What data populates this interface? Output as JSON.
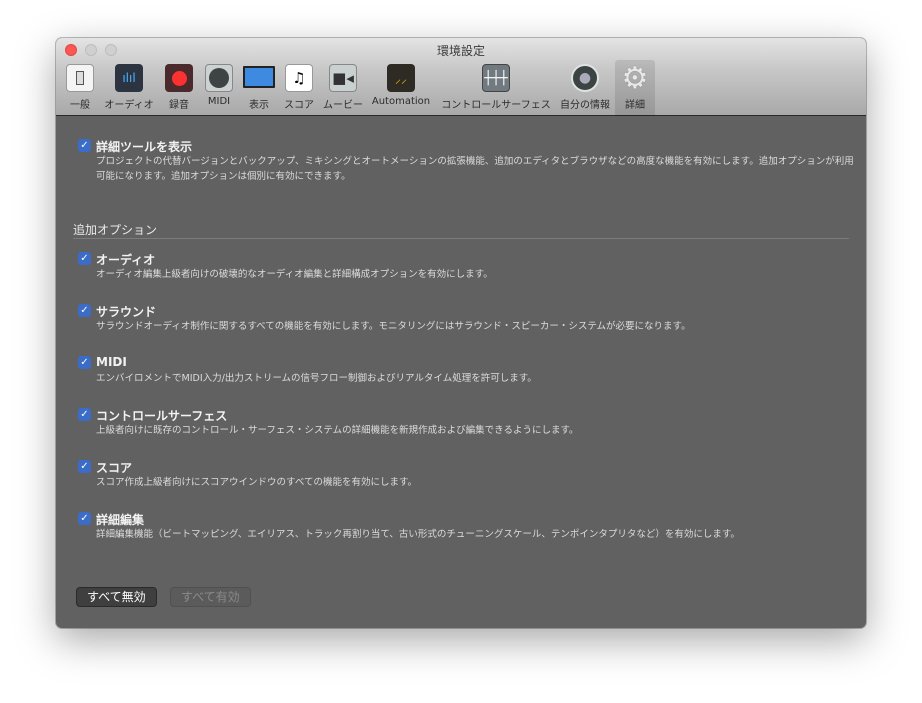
{
  "window": {
    "title": "環境設定"
  },
  "toolbar": [
    {
      "id": "general",
      "label": "一般",
      "icon": "switch-icon"
    },
    {
      "id": "audio",
      "label": "オーディオ",
      "icon": "waveform-icon"
    },
    {
      "id": "record",
      "label": "録音",
      "icon": "record-icon"
    },
    {
      "id": "midi",
      "label": "MIDI",
      "icon": "midi-port-icon"
    },
    {
      "id": "display",
      "label": "表示",
      "icon": "monitor-icon"
    },
    {
      "id": "score",
      "label": "スコア",
      "icon": "music-note-icon"
    },
    {
      "id": "movie",
      "label": "ムービー",
      "icon": "video-camera-icon"
    },
    {
      "id": "automation",
      "label": "Automation",
      "icon": "automation-icon"
    },
    {
      "id": "control-surfaces",
      "label": "コントロールサーフェス",
      "icon": "faders-icon"
    },
    {
      "id": "my-info",
      "label": "自分の情報",
      "icon": "user-icon"
    },
    {
      "id": "advanced",
      "label": "詳細",
      "icon": "gear-icon",
      "selected": true
    }
  ],
  "main_option": {
    "label": "詳細ツールを表示",
    "checked": true,
    "description": "プロジェクトの代替バージョンとバックアップ、ミキシングとオートメーションの拡張機能、追加のエディタとブラウザなどの高度な機能を有効にします。追加オプションが利用可能になります。追加オプションは個別に有効にできます。"
  },
  "section_title": "追加オプション",
  "options": [
    {
      "label": "オーディオ",
      "checked": true,
      "description": "オーディオ編集上級者向けの破壊的なオーディオ編集と詳細構成オプションを有効にします。"
    },
    {
      "label": "サラウンド",
      "checked": true,
      "description": "サラウンドオーディオ制作に関するすべての機能を有効にします。モニタリングにはサラウンド・スピーカー・システムが必要になります。"
    },
    {
      "label": "MIDI",
      "checked": true,
      "description": "エンバイロメントでMIDI入力/出力ストリームの信号フロー制御およびリアルタイム処理を許可します。"
    },
    {
      "label": "コントロールサーフェス",
      "checked": true,
      "description": "上級者向けに既存のコントロール・サーフェス・システムの詳細機能を新規作成および編集できるようにします。"
    },
    {
      "label": "スコア",
      "checked": true,
      "description": "スコア作成上級者向けにスコアウインドウのすべての機能を有効にします。"
    },
    {
      "label": "詳細編集",
      "checked": true,
      "description": "詳細編集機能（ビートマッピング、エイリアス、トラック再割り当て、古い形式のチューニングスケール、テンポインタプリタなど）を有効にします。"
    }
  ],
  "buttons": {
    "disable_all": "すべて無効",
    "enable_all": "すべて有効"
  },
  "colors": {
    "accent": "#3b6cc7",
    "content_bg": "#616161"
  }
}
